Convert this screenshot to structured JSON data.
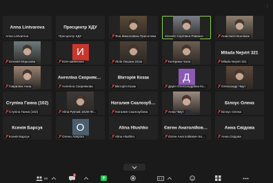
{
  "participants": [
    {
      "display": "name",
      "name": "Anna Lintvarova",
      "label": "Anna Lintvarova",
      "muted": false
    },
    {
      "display": "name",
      "name": "Пресцентр ХДУ",
      "label": "Пресцентр ХДУ",
      "muted": false
    },
    {
      "display": "video",
      "name": "",
      "label": "Яна Миколаївна Прасолова",
      "muted": true,
      "bg": "#5a4a38"
    },
    {
      "display": "video",
      "name": "",
      "label": "Євгенія Сергіївна Раванко",
      "muted": false,
      "bg": "#7a7f86",
      "active": true
    },
    {
      "display": "video",
      "name": "",
      "label": "Анастасія Волянюк",
      "muted": true,
      "bg": "#8c8070"
    },
    {
      "display": "video",
      "name": "",
      "label": "Євгенія Морозова",
      "muted": true,
      "bg": "#6c7a7c"
    },
    {
      "display": "avatar",
      "name": "",
      "label": "Юля Шевченко",
      "muted": true,
      "letter": "И",
      "color": "#c8372d"
    },
    {
      "display": "video",
      "name": "",
      "label": "Лілія Оксана 221м",
      "muted": true,
      "bg": "#4b4138"
    },
    {
      "display": "video",
      "name": "",
      "label": "Катерина Чала",
      "muted": true,
      "bg": "#6e5e52"
    },
    {
      "display": "name",
      "name": "Milada Nejvirt 321",
      "label": "Milada Nejvirt 321",
      "muted": true
    },
    {
      "display": "video",
      "name": "",
      "label": "Гаврилюк Анна",
      "muted": true,
      "bg": "#9c8474"
    },
    {
      "display": "name",
      "name": "Ангеліна Скорнякова",
      "label": "Ангеліна Скорнякова",
      "muted": true
    },
    {
      "display": "name",
      "name": "Вікторія Козак",
      "label": "Вікторія Козак",
      "muted": true
    },
    {
      "display": "avatar",
      "name": "",
      "label": "Дарія Олександрівна Ко...",
      "muted": true,
      "letter": "Д",
      "color": "#8c5ab4"
    },
    {
      "display": "video",
      "name": "",
      "label": "Олександр Чмут",
      "muted": true,
      "bg": "#5e4a3c"
    },
    {
      "display": "name",
      "name": "Ступіна Ганна (102)",
      "label": "Ступіна Ганна (102)",
      "muted": true
    },
    {
      "display": "video",
      "name": "",
      "label": "Alina Pytmak 102М ФІ...",
      "muted": true,
      "bg": "#3e3a38"
    },
    {
      "display": "name",
      "name": "Наталия Скалозубова",
      "label": "Наталия Скалозубова",
      "muted": true
    },
    {
      "display": "video",
      "name": "",
      "label": "Анна Чмут",
      "muted": true,
      "bg": "#9c8a80"
    },
    {
      "display": "name",
      "name": "Білоус Олена",
      "label": "Білоус Олена",
      "muted": true
    },
    {
      "display": "name",
      "name": "Ксенія Барсук",
      "label": "Ксенія Барсук",
      "muted": true
    },
    {
      "display": "avatar",
      "name": "",
      "label": "Олена Аверіна",
      "muted": true,
      "letter": "О",
      "color": "#4a5f70"
    },
    {
      "display": "name",
      "name": "Alina Hlushko",
      "label": "Alina Hlushko",
      "muted": true
    },
    {
      "display": "name",
      "name": "Євген Анатолійович...",
      "label": "Євген Анатолійович Бо...",
      "muted": true
    },
    {
      "display": "name",
      "name": "Анна Свідова",
      "label": "Анна Свідова",
      "muted": true
    }
  ],
  "toolbar": {
    "participants_count": "69",
    "chat_badge": "1"
  }
}
